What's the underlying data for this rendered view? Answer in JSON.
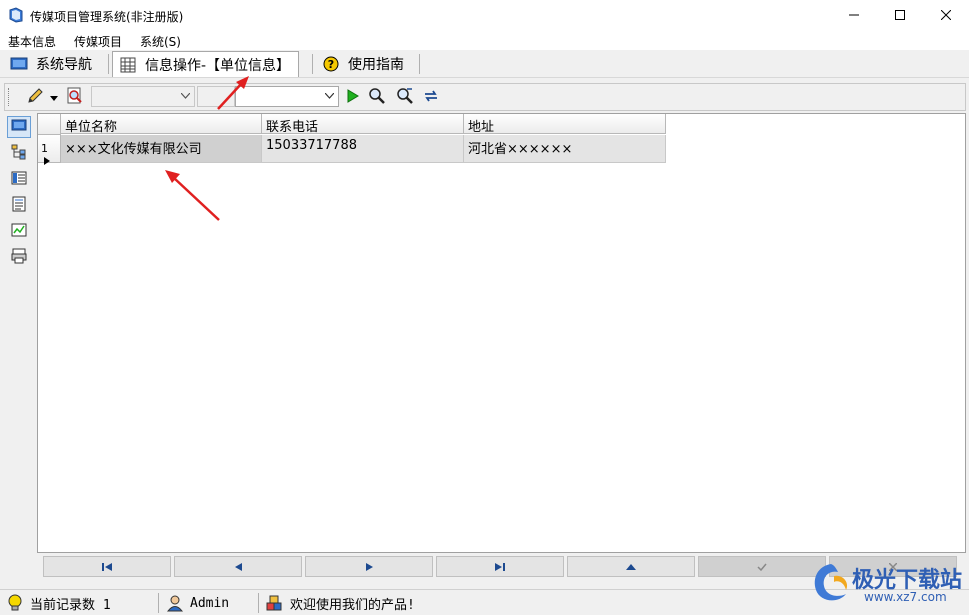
{
  "window": {
    "title": "传媒项目管理系统(非注册版)",
    "icon": "app-book-icon",
    "controls": [
      "minimize-icon",
      "maximize-icon",
      "close-icon"
    ]
  },
  "menu": [
    "基本信息",
    "传媒项目",
    "系统(S)"
  ],
  "tabs": [
    {
      "label": "系统导航",
      "icon": "monitor-icon"
    },
    {
      "label": "信息操作-【单位信息】",
      "icon": "grid-icon",
      "active": true
    },
    {
      "label": "使用指南",
      "icon": "help-icon"
    }
  ],
  "toolbar": {
    "tools": [
      "pencil-icon",
      "dropdown-arrow-icon",
      "search-doc-icon",
      "run-icon",
      "find-icon",
      "find-next-icon",
      "refresh-icon"
    ],
    "combo1_value": "",
    "combo2_value": "",
    "combo3_value": ""
  },
  "sidebar": {
    "icons": [
      "monitor-icon",
      "tree-icon",
      "list-view-icon",
      "document-icon",
      "chart-icon",
      "printer-icon"
    ]
  },
  "grid": {
    "columns": [
      "单位名称",
      "联系电话",
      "地址"
    ],
    "rows": [
      {
        "num": "1",
        "cells": [
          "×××文化传媒有限公司",
          "15033717788",
          "河北省××××××"
        ]
      }
    ]
  },
  "navigator": {
    "buttons": [
      "first-record-icon",
      "prior-record-icon",
      "next-record-icon",
      "last-record-icon",
      "insert-icon",
      "post-icon",
      "cancel-icon"
    ]
  },
  "status": {
    "records": "当前记录数 1",
    "user": "Admin",
    "message": "欢迎使用我们的产品!"
  },
  "watermark": {
    "text": "极光下载站",
    "url": "www.xz7.com"
  },
  "colors": {
    "annotation_arrow": "#e02020",
    "watermark": "#2f5fb4"
  }
}
